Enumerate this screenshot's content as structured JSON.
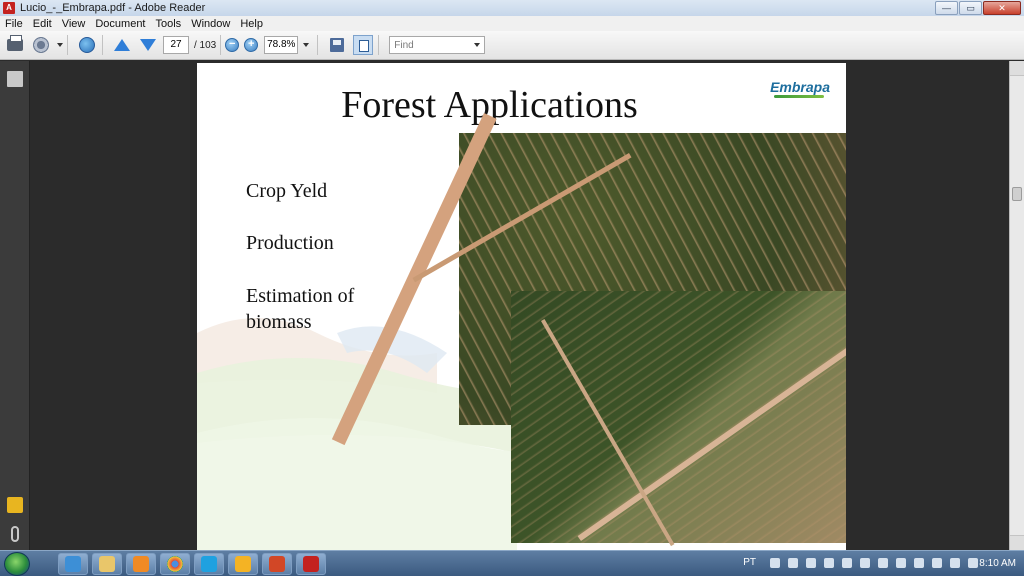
{
  "window": {
    "title": "Lucio_-_Embrapa.pdf - Adobe Reader",
    "controls": {
      "minimize": "—",
      "maximize": "▭",
      "close": "✕"
    }
  },
  "menu": [
    "File",
    "Edit",
    "View",
    "Document",
    "Tools",
    "Window",
    "Help"
  ],
  "toolbar": {
    "current_page": "27",
    "page_total": "/ 103",
    "zoom": "78.8%",
    "find_placeholder": "Find"
  },
  "slide": {
    "title": "Forest Applications",
    "logo": "Embrapa",
    "bullets": [
      "Crop Yeld",
      "Production",
      "Estimation of",
      "biomass"
    ]
  },
  "taskbar": {
    "language": "PT",
    "clock": "8:10 AM"
  },
  "icons": {
    "print": "print-icon",
    "create": "create-pdf-icon",
    "collab": "collaborate-icon",
    "prev": "prev-page-icon",
    "next": "next-page-icon",
    "zoom_out": "zoom-out-icon",
    "zoom_in": "zoom-in-icon",
    "save": "save-icon",
    "fit": "fit-page-icon"
  }
}
